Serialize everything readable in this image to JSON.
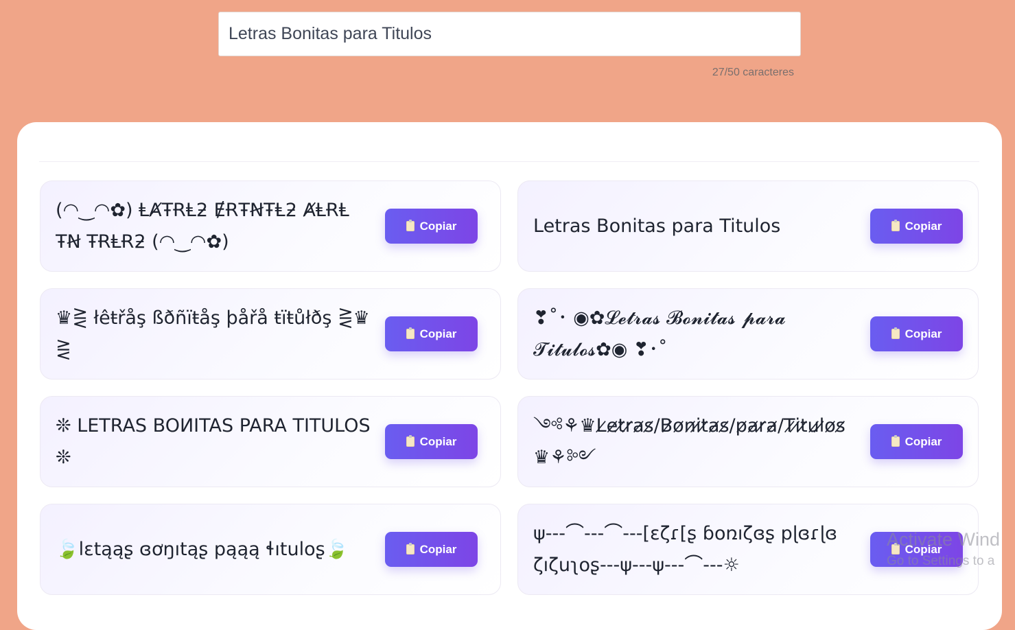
{
  "input": {
    "value": "Letras Bonitas para Titulos",
    "placeholder": ""
  },
  "char_count": "27/50 caracteres",
  "copy_label": "Copiar",
  "results": [
    {
      "text": "(◠‿◠✿) ⱠȺŦɌⱠƻ ɆɌŦꞤŦⱠƻ ȺⱠɌⱠ ŦꞤ ŦɌⱠɌƻ (◠‿◠✿)"
    },
    {
      "text": "Letras Bonitas para Titulos"
    },
    {
      "text": "♛⋛ łêŧřåş ßðñïŧåş þåřå ŧïŧůłðş ⋛♛ ⋛"
    },
    {
      "text": "❣˚･ ◉✿𝓛𝓮𝓽𝓻𝓪𝓼 𝓑𝓸𝓷𝓲𝓽𝓪𝓼 𝓹𝓪𝓻𝓪 𝓣𝓲𝓽𝓾𝓵𝓸𝓼✿◉ ❣･˚"
    },
    {
      "text": "❊ LETRAS BOИITAS PARA TITULOS ❊"
    },
    {
      "text": "༺⚘♛L̷e̷t̷r̷a̷s̷/B̷o̷n̷i̷t̷a̷s̷/p̷a̷r̷a̷/T̷i̷t̷u̷l̷o̷s̷♛⚘༻"
    },
    {
      "text": "🍃lɛtąąʂ ɞơŋıtąʂ pąąą ɬıtuloʂ🍃"
    },
    {
      "text": "ψ---⌒---⌒---[ɛζɾ[ʂ ɓօռıζɞʂ pɭɞɾɭɞ ζıζuʅօʂ---ψ---ψ---⌒---☼"
    }
  ],
  "watermark": {
    "line1": "Activate Wind",
    "line2": "Go to Settings to a"
  }
}
